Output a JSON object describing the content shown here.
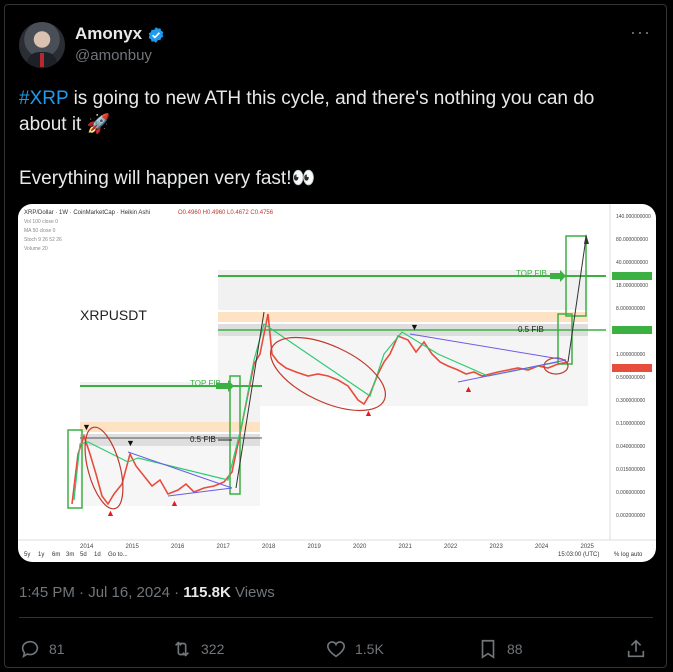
{
  "user": {
    "name": "Amonyx",
    "handle": "@amonbuy"
  },
  "tweet": {
    "hashtag": "#XRP",
    "line1_rest": " is going to new ATH this cycle, and there's nothing you can do about it 🚀",
    "line2": "Everything will happen very fast!👀",
    "timestamp": "1:45 PM · Jul 16, 2024 · ",
    "views_count": "115.8K",
    "views_label": " Views"
  },
  "chart_image": {
    "header": "XRP/Dollar · 1W · CoinMarketCap · Heikin Ashi",
    "ohlc": "O0.4960 H0.4960 L0.4672 C0.4756",
    "symbol_label": "XRPUSDT",
    "top_fib_1": "TOP FIB",
    "fib05_1": "0.5 FIB",
    "top_fib_2": "TOP FIB",
    "fib05_2": "0.5 FIB",
    "x_ticks": [
      "2014",
      "2015",
      "2016",
      "2017",
      "2018",
      "2019",
      "2020",
      "2021",
      "2022",
      "2023",
      "2024",
      "2025"
    ],
    "y_ticks": [
      "140.000000000",
      "80.000000000",
      "40.000000000",
      "18.000000000",
      "8.000000000",
      "4.000000000",
      "1.000000000",
      "0.500000000",
      "0.300000000",
      "0.100000000",
      "0.040000000",
      "0.015000000",
      "0.006000000",
      "0.002000000"
    ],
    "timeframes": [
      "5y",
      "1y",
      "6m",
      "3m",
      "5d",
      "1d",
      "Go to..."
    ],
    "clock": "15:03:00 (UTC)",
    "scale_opts": "% log auto"
  },
  "actions": {
    "replies": "81",
    "reposts": "322",
    "likes": "1.5K",
    "bookmarks": "88"
  },
  "colors": {
    "accent": "#1d9bf0",
    "muted": "#71767b",
    "text": "#e7e9ea"
  }
}
